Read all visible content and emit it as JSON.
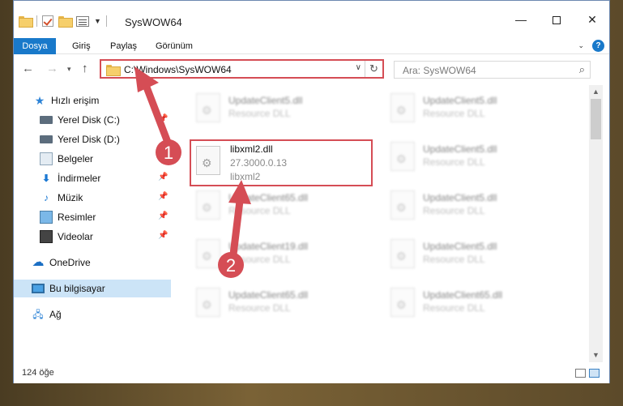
{
  "window": {
    "title": "SysWOW64"
  },
  "ribbon": {
    "tabs": [
      "Dosya",
      "Giriş",
      "Paylaş",
      "Görünüm"
    ]
  },
  "navigation": {
    "address_path": "C:\\Windows\\SysWOW64",
    "search_placeholder": "Ara: SysWOW64"
  },
  "sidebar": {
    "items": [
      {
        "label": "Hızlı erişim",
        "icon": "star-icon",
        "pinned": false
      },
      {
        "label": "Yerel Disk (C:)",
        "icon": "drive-icon",
        "pinned": true
      },
      {
        "label": "Yerel Disk (D:)",
        "icon": "drive-icon",
        "pinned": false
      },
      {
        "label": "Belgeler",
        "icon": "documents-icon",
        "pinned": true
      },
      {
        "label": "İndirmeler",
        "icon": "downloads-icon",
        "pinned": true
      },
      {
        "label": "Müzik",
        "icon": "music-icon",
        "pinned": true
      },
      {
        "label": "Resimler",
        "icon": "pictures-icon",
        "pinned": true
      },
      {
        "label": "Videolar",
        "icon": "videos-icon",
        "pinned": true
      },
      {
        "label": "OneDrive",
        "icon": "onedrive-icon",
        "pinned": false
      },
      {
        "label": "Bu bilgisayar",
        "icon": "this-pc-icon",
        "pinned": false,
        "selected": true
      },
      {
        "label": "Ağ",
        "icon": "network-icon",
        "pinned": false
      }
    ]
  },
  "files": {
    "highlighted": {
      "name": "libxml2.dll",
      "version": "27.3000.0.13",
      "description": "libxml2"
    },
    "left_column": [
      {
        "name": "UpdateClient5.dll",
        "type": "Resource DLL"
      },
      {
        "name": "UpdateClient65.dll",
        "type": "Resource DLL"
      },
      {
        "name": "UpdateClient19.dll",
        "type": "Resource DLL"
      },
      {
        "name": "UpdateClient65.dll",
        "type": "Resource DLL"
      }
    ],
    "right_column": [
      {
        "name": "UpdateClient5.dll",
        "type": "Resource DLL"
      },
      {
        "name": "UpdateClient5.dll",
        "type": "Resource DLL"
      },
      {
        "name": "UpdateClient5.dll",
        "type": "Resource DLL"
      },
      {
        "name": "UpdateClient5.dll",
        "type": "Resource DLL"
      },
      {
        "name": "UpdateClient65.dll",
        "type": "Resource DLL"
      }
    ]
  },
  "status": {
    "item_count": "124 öğe"
  },
  "annotations": {
    "step1": "1",
    "step2": "2",
    "color": "#d54d55"
  }
}
